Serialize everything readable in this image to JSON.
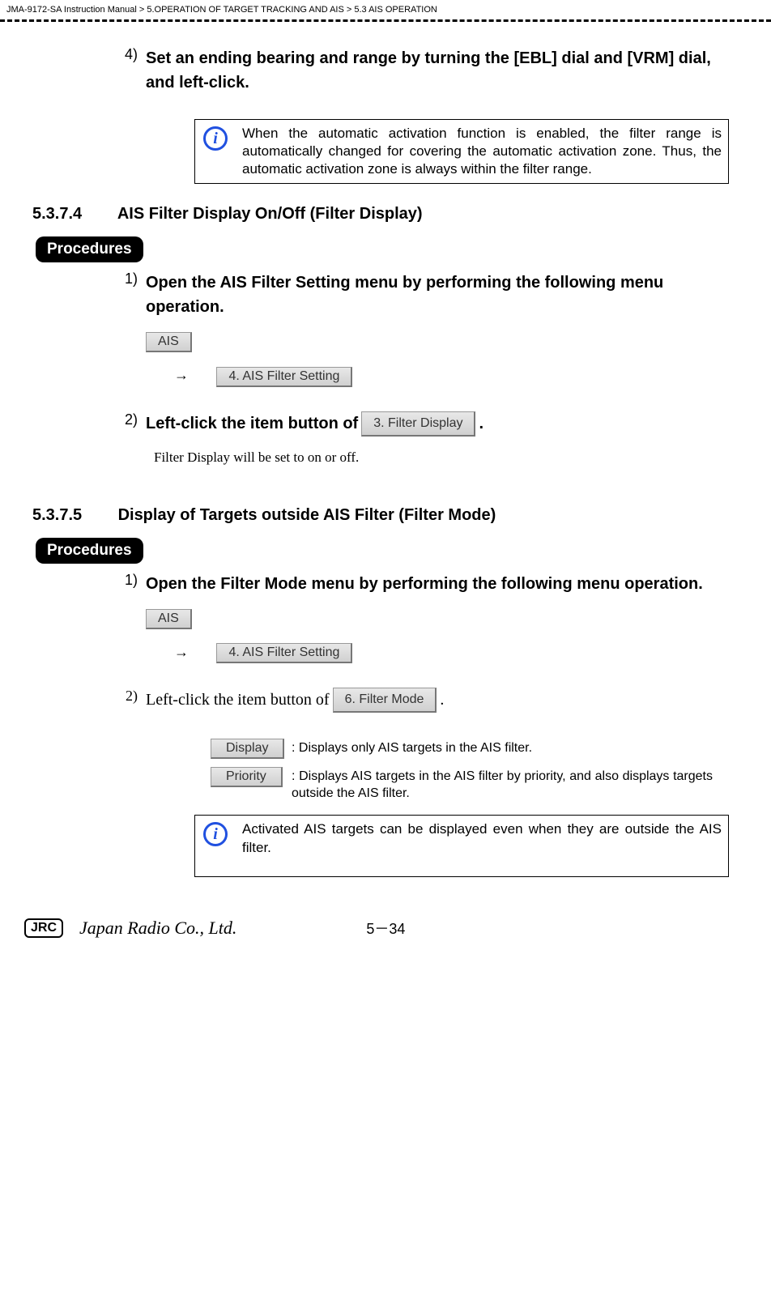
{
  "header": {
    "breadcrumb": "JMA-9172-SA Instruction Manual > 5.OPERATION OF TARGET TRACKING AND AIS > 5.3  AIS OPERATION"
  },
  "step4": {
    "num": "4)",
    "text": "Set an ending bearing and range by turning the [EBL] dial and [VRM] dial, and left-click."
  },
  "info1": {
    "text": "When the automatic activation function is enabled, the filter range is automatically changed for covering the automatic activation zone. Thus, the automatic activation zone is always within the filter range."
  },
  "section574": {
    "num": "5.3.7.4",
    "title": "AIS Filter Display On/Off (Filter Display)"
  },
  "procedures_label": "Procedures",
  "step574_1": {
    "num": "1)",
    "text": "Open the AIS Filter Setting menu by performing the following menu operation."
  },
  "buttons": {
    "ais": "AIS",
    "ais_filter_setting": "4. AIS Filter Setting",
    "filter_display": "3. Filter Display",
    "filter_mode": "6. Filter Mode",
    "display": "Display",
    "priority": "Priority"
  },
  "arrow": "→",
  "step574_2": {
    "num": "2)",
    "text_before": "Left-click the item button of ",
    "text_after": " ."
  },
  "body574": "Filter Display will be set to on or off.",
  "section575": {
    "num": "5.3.7.5",
    "title": "Display of Targets outside AIS Filter (Filter Mode)"
  },
  "step575_1": {
    "num": "1)",
    "text": "Open the Filter Mode menu by performing the following menu operation."
  },
  "step575_2": {
    "num": "2)",
    "text_before": "Left-click the item button of ",
    "text_after": "  ."
  },
  "options": {
    "display_desc": ": Displays only AIS targets in the AIS filter.",
    "priority_desc": ": Displays AIS targets in the AIS filter by priority, and also displays targets outside the AIS filter."
  },
  "info2": {
    "text": "Activated AIS targets can be displayed even when they are outside the AIS filter."
  },
  "footer": {
    "jrc_box": "JRC",
    "jrc_text": "Japan Radio Co., Ltd.",
    "page": "5－34"
  }
}
